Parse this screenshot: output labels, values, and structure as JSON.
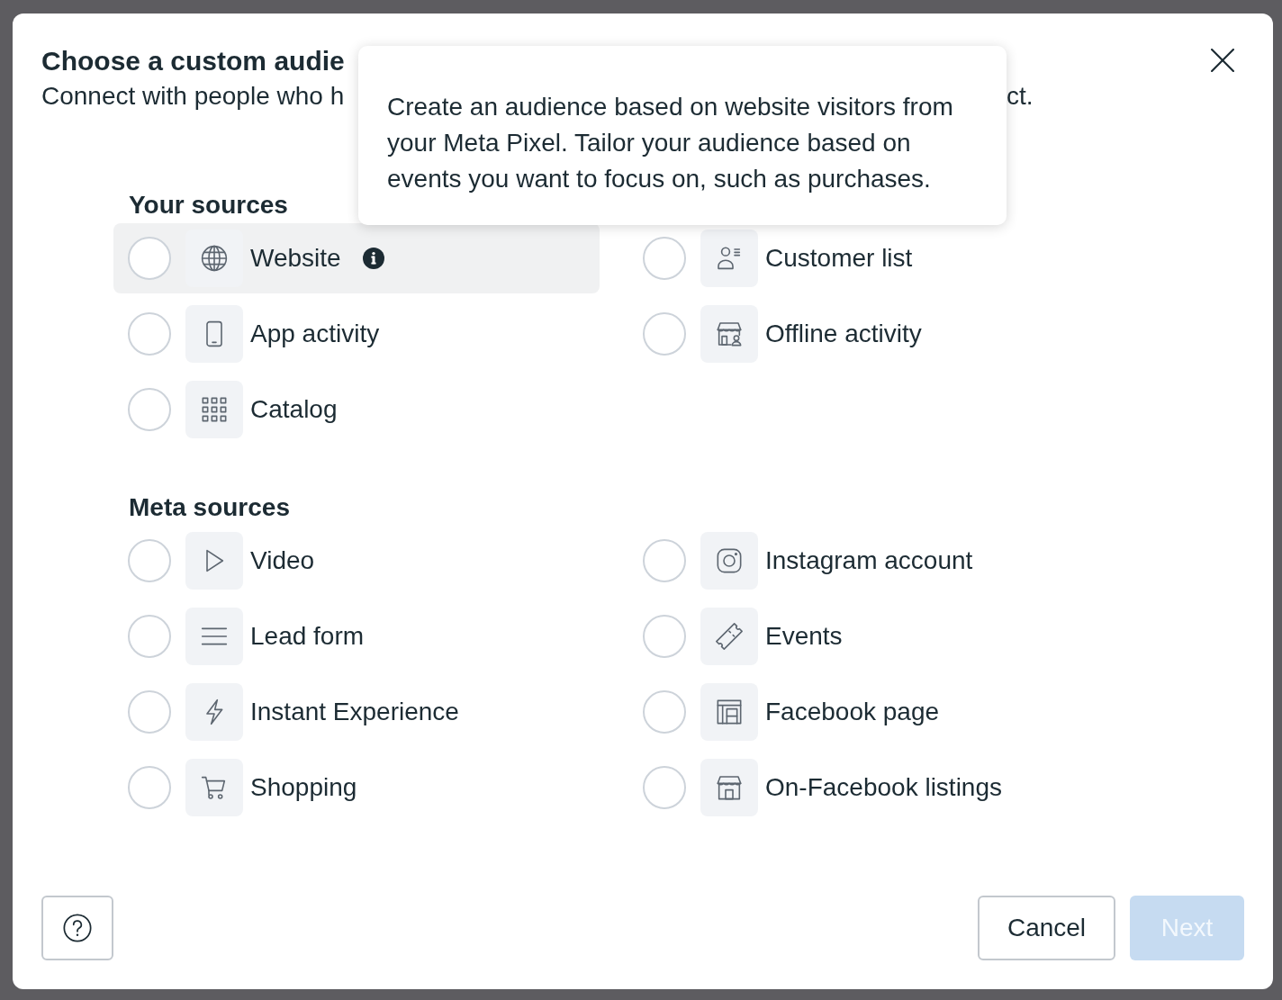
{
  "dialog": {
    "title": "Choose a custom audie",
    "subtitle_parts": [
      "Connect with people who h",
      "ct."
    ]
  },
  "tooltip": {
    "text": "Create an audience based on website visitors from your Meta Pixel. Tailor your audience based on events you want to focus on, such as purchases."
  },
  "sections": [
    {
      "heading": "Your sources",
      "items": [
        {
          "label": "Website",
          "selected": false,
          "hovered": true,
          "info": true
        },
        {
          "label": "Customer list",
          "selected": false,
          "hovered": false,
          "info": false
        },
        {
          "label": "App activity",
          "selected": false,
          "hovered": false,
          "info": false
        },
        {
          "label": "Offline activity",
          "selected": false,
          "hovered": false,
          "info": false
        },
        {
          "label": "Catalog",
          "selected": false,
          "hovered": false,
          "info": false
        }
      ]
    },
    {
      "heading": "Meta sources",
      "items": [
        {
          "label": "Video",
          "selected": false,
          "hovered": false,
          "info": false
        },
        {
          "label": "Instagram account",
          "selected": false,
          "hovered": false,
          "info": false
        },
        {
          "label": "Lead form",
          "selected": false,
          "hovered": false,
          "info": false
        },
        {
          "label": "Events",
          "selected": false,
          "hovered": false,
          "info": false
        },
        {
          "label": "Instant Experience",
          "selected": false,
          "hovered": false,
          "info": false
        },
        {
          "label": "Facebook page",
          "selected": false,
          "hovered": false,
          "info": false
        },
        {
          "label": "Shopping",
          "selected": false,
          "hovered": false,
          "info": false
        },
        {
          "label": "On-Facebook listings",
          "selected": false,
          "hovered": false,
          "info": false
        }
      ]
    }
  ],
  "footer": {
    "cancel": "Cancel",
    "next": {
      "label": "Next",
      "disabled": true
    }
  }
}
